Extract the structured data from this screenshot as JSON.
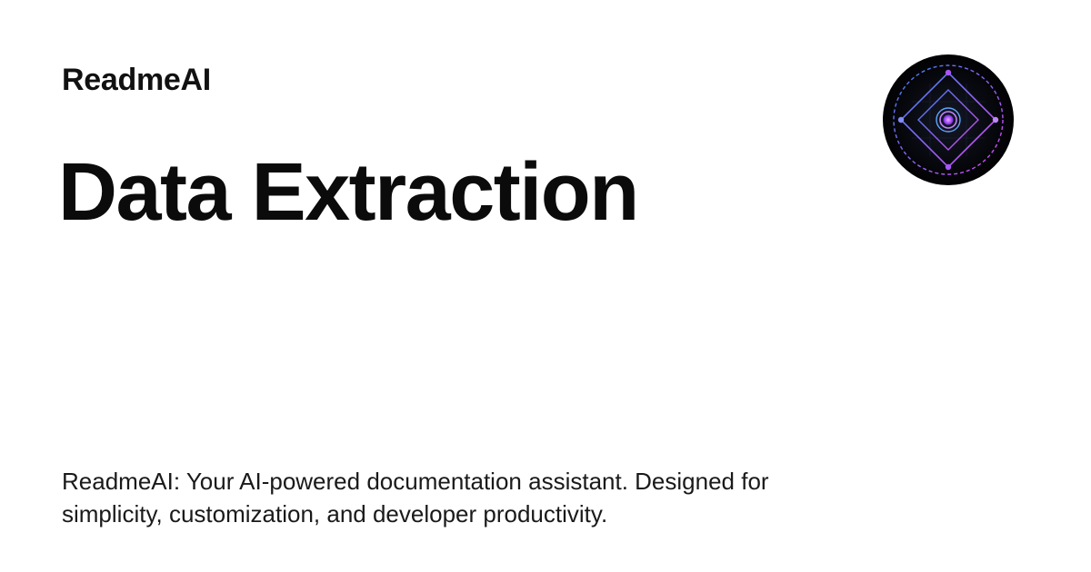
{
  "brand": {
    "name": "ReadmeAI"
  },
  "page": {
    "title": "Data Extraction",
    "description": "ReadmeAI: Your AI-powered documentation assistant. Designed for simplicity, customization, and developer productivity."
  },
  "logo": {
    "icon": "diamond-target-icon",
    "colors": {
      "background": "#05060a",
      "blue": "#3b82f6",
      "purple": "#a855f7",
      "magenta": "#d946ef"
    }
  }
}
